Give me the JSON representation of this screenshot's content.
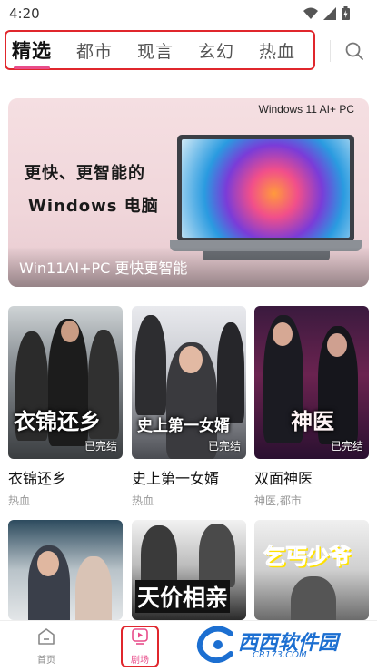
{
  "status_bar": {
    "time": "4:20"
  },
  "tabs": [
    {
      "label": "精选",
      "active": true
    },
    {
      "label": "都市",
      "active": false
    },
    {
      "label": "现言",
      "active": false
    },
    {
      "label": "玄幻",
      "active": false
    },
    {
      "label": "热血",
      "active": false
    }
  ],
  "banner": {
    "badge": "Windows 11 AI+ PC",
    "headline_1": "更快、更智能的",
    "headline_2": "Windows 电脑",
    "caption": "Win11AI+PC 更快更智能"
  },
  "dramas": [
    {
      "title": "衣锦还乡",
      "tags": "热血",
      "status": "已完结",
      "art_text": "衣锦还乡"
    },
    {
      "title": "史上第一女婿",
      "tags": "热血",
      "status": "已完结",
      "art_text": "史上第一女婿"
    },
    {
      "title": "双面神医",
      "tags": "神医,都市",
      "status": "已完结",
      "art_text": "神医"
    }
  ],
  "dramas_row2": [
    {
      "art_text": ""
    },
    {
      "art_text": "天价相亲"
    },
    {
      "art_text": "乞丐少爷"
    }
  ],
  "bottom_nav": [
    {
      "label": "首页",
      "active": false
    },
    {
      "label": "剧场",
      "active": true
    }
  ],
  "watermark": {
    "main": "西西软件园",
    "sub": "CR173.COM"
  },
  "colors": {
    "accent": "#e84d8a",
    "highlight_border": "#e0262c"
  }
}
